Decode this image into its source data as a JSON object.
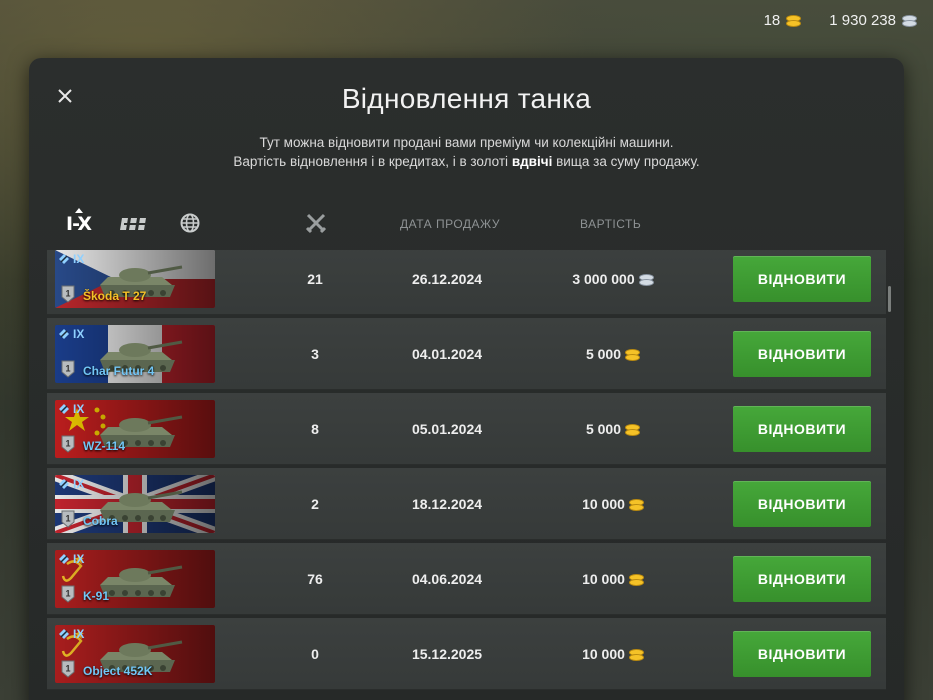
{
  "currency": {
    "gold": "18",
    "credits": "1 930 238"
  },
  "dialog": {
    "title": "Відновлення танка",
    "desc_line1": "Тут можна відновити продані вами преміум чи колекційні машини.",
    "desc_line2_pre": "Вартість відновлення і в кредитах, і в золоті ",
    "desc_line2_bold": "вдвічі",
    "desc_line2_post": " вища за суму продажу."
  },
  "filters": {
    "tier_tab": "I-X"
  },
  "columns": {
    "date": "ДАТА ПРОДАЖУ",
    "cost": "ВАРТІСТЬ"
  },
  "restore_label": "ВІДНОВИТИ",
  "tanks": [
    {
      "tier": "IX",
      "name": "Škoda T 27",
      "premium": true,
      "battles": "21",
      "date": "26.12.2024",
      "cost": "3 000 000",
      "currency": "credits",
      "mastery": "1",
      "flag": "czech"
    },
    {
      "tier": "IX",
      "name": "Char Futur 4",
      "premium": false,
      "battles": "3",
      "date": "04.01.2024",
      "cost": "5 000",
      "currency": "gold",
      "mastery": "1",
      "flag": "france"
    },
    {
      "tier": "IX",
      "name": "WZ-114",
      "premium": false,
      "battles": "8",
      "date": "05.01.2024",
      "cost": "5 000",
      "currency": "gold",
      "mastery": "1",
      "flag": "china"
    },
    {
      "tier": "IX",
      "name": "Cobra",
      "premium": false,
      "battles": "2",
      "date": "18.12.2024",
      "cost": "10 000",
      "currency": "gold",
      "mastery": "1",
      "flag": "uk"
    },
    {
      "tier": "IX",
      "name": "K-91",
      "premium": false,
      "battles": "76",
      "date": "04.06.2024",
      "cost": "10 000",
      "currency": "gold",
      "mastery": "1",
      "flag": "ussr"
    },
    {
      "tier": "IX",
      "name": "Object 452K",
      "premium": false,
      "battles": "0",
      "date": "15.12.2025",
      "cost": "10 000",
      "currency": "gold",
      "mastery": "1",
      "flag": "ussr"
    }
  ]
}
